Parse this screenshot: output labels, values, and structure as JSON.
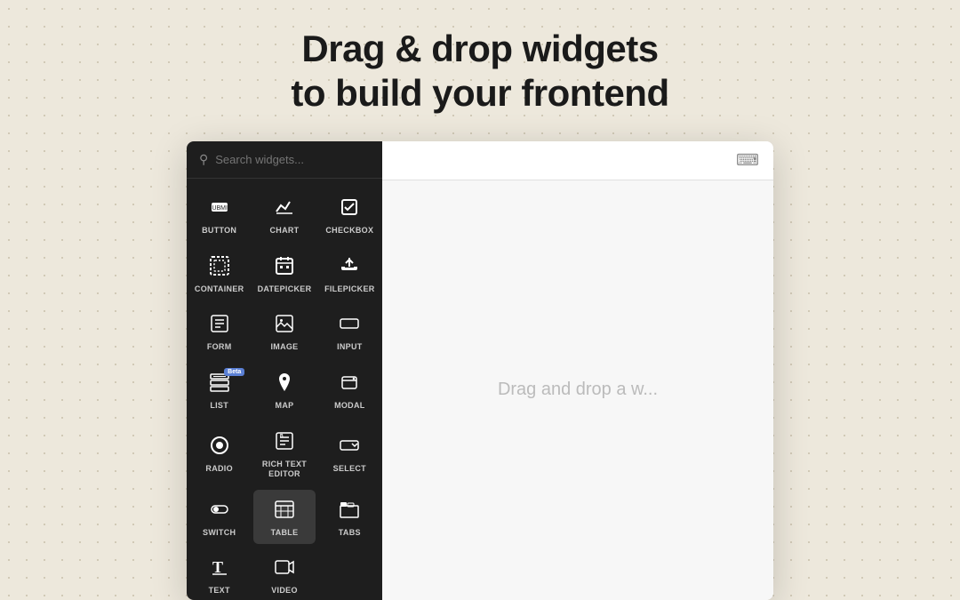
{
  "headline": {
    "line1": "Drag & drop widgets",
    "line2": "to build your frontend"
  },
  "search": {
    "placeholder": "Search widgets..."
  },
  "canvas": {
    "drop_hint": "Drag and drop a w..."
  },
  "widgets": [
    {
      "id": "button",
      "label": "BUTTON",
      "icon": "button",
      "beta": false,
      "active": false
    },
    {
      "id": "chart",
      "label": "CHART",
      "icon": "chart",
      "beta": false,
      "active": false
    },
    {
      "id": "checkbox",
      "label": "CHECKBOX",
      "icon": "checkbox",
      "beta": false,
      "active": false
    },
    {
      "id": "container",
      "label": "CONTAINER",
      "icon": "container",
      "beta": false,
      "active": false
    },
    {
      "id": "datepicker",
      "label": "DATEPICKER",
      "icon": "datepicker",
      "beta": false,
      "active": false
    },
    {
      "id": "filepicker",
      "label": "FILEPICKER",
      "icon": "filepicker",
      "beta": false,
      "active": false
    },
    {
      "id": "form",
      "label": "FORM",
      "icon": "form",
      "beta": false,
      "active": false
    },
    {
      "id": "image",
      "label": "IMAGE",
      "icon": "image",
      "beta": false,
      "active": false
    },
    {
      "id": "input",
      "label": "INPUT",
      "icon": "input",
      "beta": false,
      "active": false
    },
    {
      "id": "list",
      "label": "LIST",
      "icon": "list",
      "beta": true,
      "active": false
    },
    {
      "id": "map",
      "label": "MAP",
      "icon": "map",
      "beta": false,
      "active": false
    },
    {
      "id": "modal",
      "label": "MODAL",
      "icon": "modal",
      "beta": false,
      "active": false
    },
    {
      "id": "radio",
      "label": "RADIO",
      "icon": "radio",
      "beta": false,
      "active": false
    },
    {
      "id": "rte",
      "label": "RICH TEXT\nEDITOR",
      "icon": "rte",
      "beta": false,
      "active": false
    },
    {
      "id": "select",
      "label": "SELECT",
      "icon": "select",
      "beta": false,
      "active": false
    },
    {
      "id": "switch",
      "label": "SWITCH",
      "icon": "switch",
      "beta": false,
      "active": false
    },
    {
      "id": "table",
      "label": "TABLE",
      "icon": "table",
      "beta": false,
      "active": true
    },
    {
      "id": "tabs",
      "label": "TABS",
      "icon": "tabs",
      "beta": false,
      "active": false
    },
    {
      "id": "text",
      "label": "TEXT",
      "icon": "text",
      "beta": false,
      "active": false
    },
    {
      "id": "video",
      "label": "VIDEO",
      "icon": "video",
      "beta": false,
      "active": false
    }
  ]
}
